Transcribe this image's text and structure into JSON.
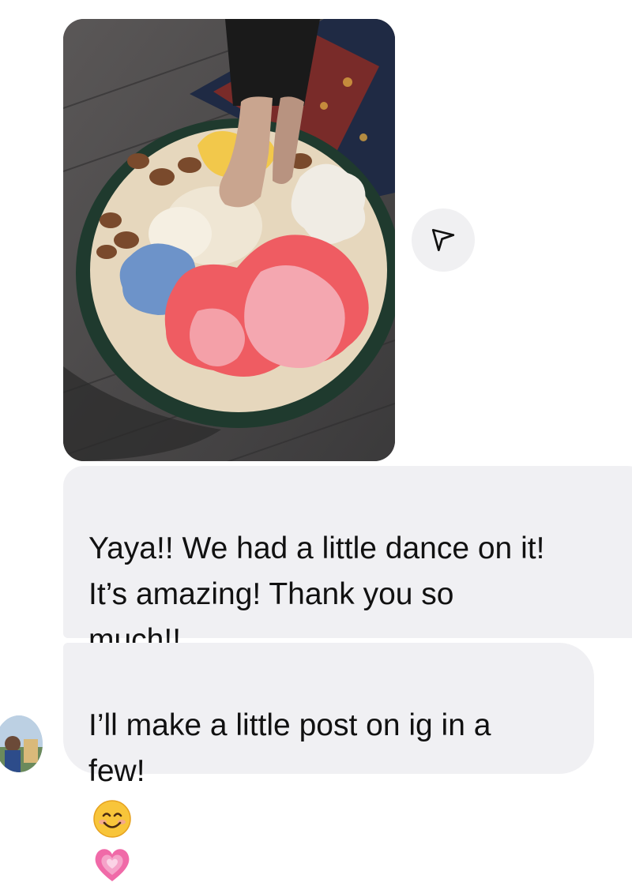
{
  "thread": {
    "messages": [
      {
        "text": "Yaya!! We had a little dance on it!\nIt’s amazing! Thank you so\nmuch!!"
      },
      {
        "text": "I’ll make a little post on ig in a\nfew!"
      }
    ]
  },
  "icons": {
    "share": "paper-plane-icon",
    "emoji_smile": "smiling-face-emoji",
    "emoji_heart": "growing-heart-emoji"
  },
  "colors": {
    "bubble_bg": "#f0f0f3",
    "text": "#111111",
    "share_button_bg": "#f0f0f2",
    "heart": "#f06aa8"
  }
}
